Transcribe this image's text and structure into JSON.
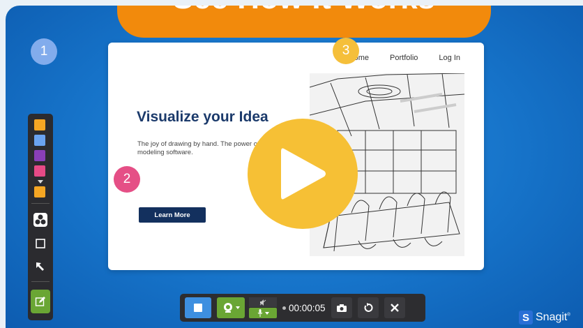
{
  "banner": {
    "title": "See How It Works"
  },
  "mockup": {
    "nav": [
      "Home",
      "Portfolio",
      "Log In"
    ],
    "headline": "Visualize your Idea",
    "body": "The joy of drawing by hand. The power of 3D modeling software.",
    "cta_label": "Learn More",
    "steps": [
      "1",
      "2",
      "3"
    ]
  },
  "toolbar": {
    "swatches": [
      "#f5a623",
      "#6aa3f0",
      "#8a3fb8",
      "#e64a86",
      "#f5a623"
    ],
    "tools": [
      "steps-icon",
      "rectangle-icon",
      "arrow-icon",
      "edit-icon"
    ]
  },
  "recorder": {
    "timer": "00:00:05",
    "buttons": [
      "stop-icon",
      "webcam-icon",
      "system-audio-icon",
      "microphone-icon",
      "screenshot-icon",
      "restart-icon",
      "close-icon"
    ]
  },
  "brand": {
    "name": "Snagit",
    "mark": "®"
  },
  "colors": {
    "accent_orange": "#f28a0c",
    "play_yellow": "#f6c035",
    "background_blue": "#1673c9",
    "green": "#6aa634"
  }
}
